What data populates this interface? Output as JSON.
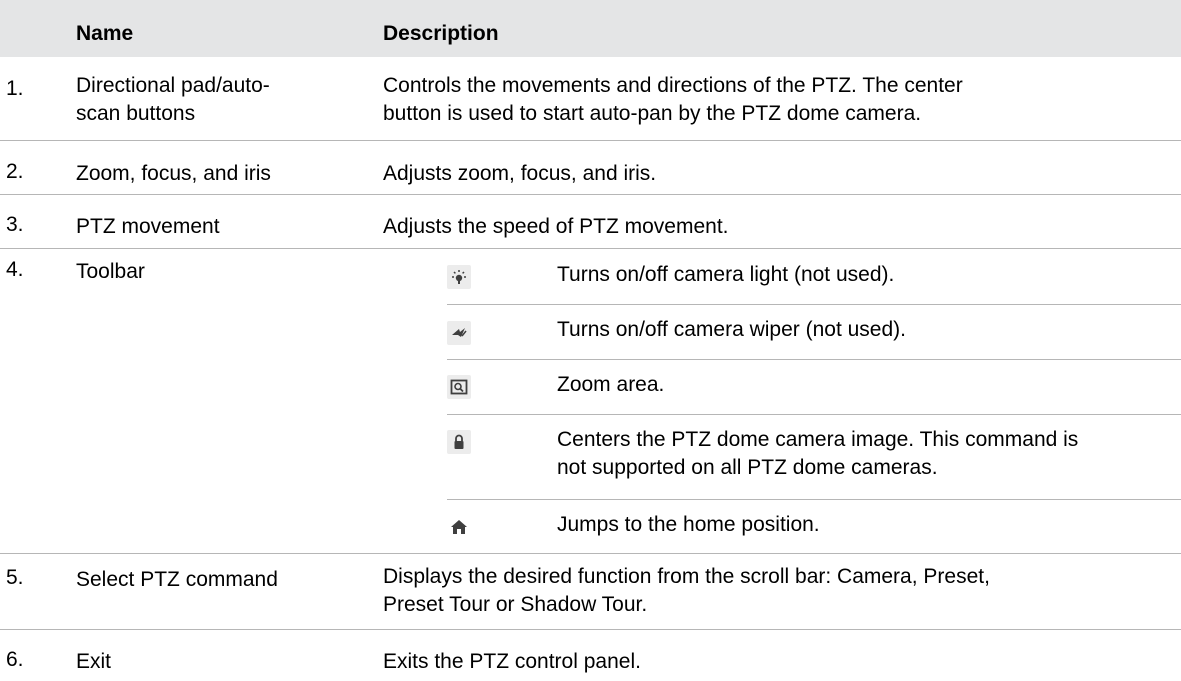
{
  "header": {
    "name": "Name",
    "description": "Description"
  },
  "rows": [
    {
      "number": "1.",
      "name_lines": [
        "Directional pad/auto-",
        "scan buttons"
      ],
      "desc_lines": [
        "Controls the movements and directions of the PTZ. The center",
        "button is used to start auto-pan by the PTZ dome camera."
      ]
    },
    {
      "number": "2.",
      "name": "Zoom, focus, and iris",
      "description": "Adjusts zoom, focus, and iris."
    },
    {
      "number": "3.",
      "name": "PTZ movement",
      "description": "Adjusts the speed of PTZ movement."
    },
    {
      "number": "4.",
      "name": "Toolbar",
      "items": [
        {
          "icon": "light-bulb-icon",
          "text": "Turns on/off camera light (not used)."
        },
        {
          "icon": "wiper-icon",
          "text": "Turns on/off camera wiper (not used)."
        },
        {
          "icon": "zoom-area-icon",
          "text": "Zoom area."
        },
        {
          "icon": "lock-icon",
          "text_lines": [
            "Centers the PTZ dome camera image. This command is",
            "not supported on all PTZ dome cameras."
          ]
        },
        {
          "icon": "home-icon",
          "text": "Jumps to the home position."
        }
      ]
    },
    {
      "number": "5.",
      "name": "Select PTZ command",
      "desc_lines": [
        "Displays the desired function from the scroll bar: Camera, Preset,",
        "Preset Tour or Shadow Tour."
      ]
    },
    {
      "number": "6.",
      "name": "Exit",
      "description": "Exits the PTZ control panel."
    }
  ],
  "colors": {
    "header_bg": "#e4e5e6",
    "divider": "#b6b6b6",
    "icon_bg": "#ececec",
    "icon_fg": "#3f3f3f"
  }
}
